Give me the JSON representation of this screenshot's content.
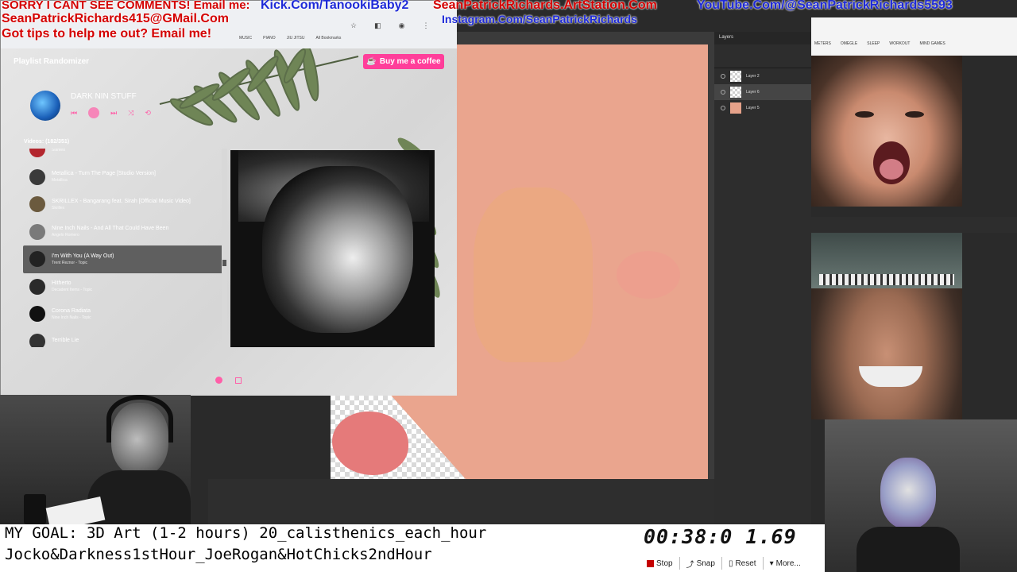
{
  "overlay": {
    "line1": "SORRY I CANT SEE COMMENTS! Email me:",
    "email": "SeanPatrickRichards415@GMail.Com",
    "tips": "Got tips to help me out? Email me!",
    "kick": "Kick.Com/TanookiBaby2",
    "artstation": "SeanPatrickRichards.ArtStation.Com",
    "youtube": "YouTube.Com/@SeanPatrickRichards5593",
    "instagram": "Instagram.Com/SeanPatrickRichards"
  },
  "browser": {
    "bookmarks": [
      "MUSIC",
      "PIANO",
      "JIU JITSU",
      "All Bookmarks"
    ]
  },
  "app": {
    "title": "Playlist Randomizer",
    "coffee_label": "Buy me a coffee",
    "playlist_name": "DARK NIN STUFF",
    "videos_count": "Videos: (182/351)",
    "items": [
      {
        "title": "",
        "sub": "Slanted",
        "color": "#b3262e"
      },
      {
        "title": "Metallica - Turn The Page [Studio Version]",
        "sub": "Metallica",
        "color": "#3a3a3a"
      },
      {
        "title": "SKRILLEX - Bangarang feat. Sirah [Official Music Video]",
        "sub": "Skrillex",
        "color": "#6b5a3e"
      },
      {
        "title": "Nine Inch Nails - And All That Could Have Been",
        "sub": "Angelo Romero",
        "color": "#7a7a7a"
      },
      {
        "title": "I'm With You (A Way Out)",
        "sub": "Trent Reznor - Topic",
        "color": "#222222"
      },
      {
        "title": "Hitherto",
        "sub": "Decadent Items - Topic",
        "color": "#2a2a2a"
      },
      {
        "title": "Corona Radiata",
        "sub": "Nine Inch Nails - Topic",
        "color": "#111111"
      },
      {
        "title": "Terrible Lie",
        "sub": "",
        "color": "#333333"
      }
    ],
    "accent": "#ff5fa8"
  },
  "photoshop": {
    "layers_tab": "Layers",
    "layers": [
      "Layer 2",
      "Layer 6",
      "Layer 5"
    ]
  },
  "bottom": {
    "goal_line1": "MY GOAL: 3D Art (1-2 hours) 20_calisthenics_each_hour",
    "goal_line2": "Jocko&Darkness1stHour_JoeRogan&HotChicks2ndHour",
    "timer": "00:38:0 1.69",
    "stop": "Stop",
    "snap": "Snap",
    "reset": "Reset",
    "more": "More..."
  },
  "browser2": {
    "bookmarks": [
      "METERS",
      "OMEGLE",
      "SLEEP",
      "WORKOUT",
      "MIND GAMES"
    ]
  }
}
